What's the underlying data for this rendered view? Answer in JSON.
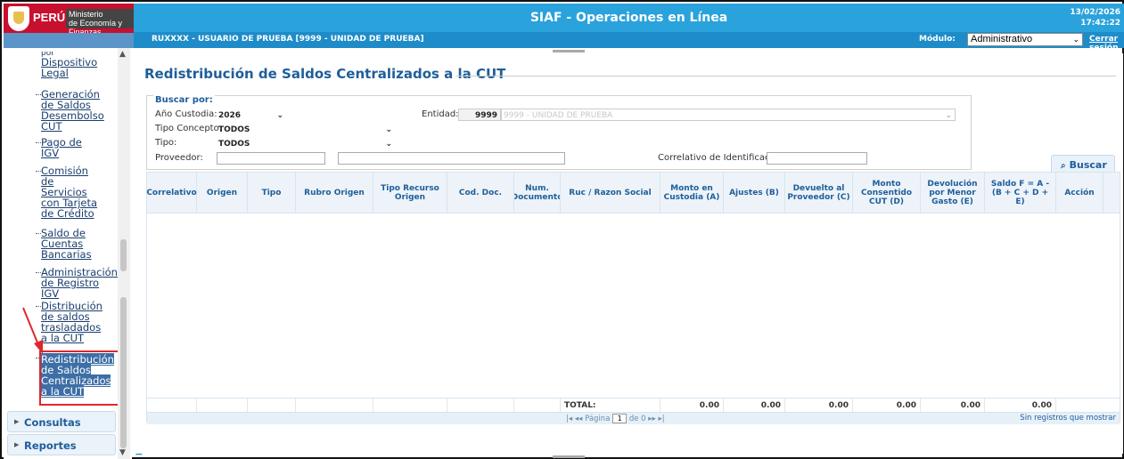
{
  "header": {
    "brand": "PERÚ",
    "ministry_line1": "Ministerio",
    "ministry_line2": "de Economía y Finanzas",
    "app_title": "SIAF - Operaciones en Línea",
    "date": "13/02/2026",
    "time": "17:42:22",
    "user": "RUXXXX - USUARIO DE PRUEBA [9999 - UNIDAD DE PRUEBA]",
    "module_label": "Módulo:",
    "module_value": "Administrativo",
    "logout": "Cerrar sesión"
  },
  "sidebar": {
    "items": [
      {
        "label": "por Dispositivo Legal"
      },
      {
        "label": "Generación de Saldos Desembolso CUT"
      },
      {
        "label": "Pago de IGV"
      },
      {
        "label": "Comisión de Servicios con Tarjeta de Crédito"
      },
      {
        "label": "Saldo de Cuentas Bancarias"
      },
      {
        "label": "Administración de Registro IGV"
      },
      {
        "label": "Distribución de saldos trasladados a la CUT"
      }
    ],
    "active_item": "Redistribución de Saldos Centralizados a la CUT",
    "sections": [
      {
        "label": "Consultas"
      },
      {
        "label": "Reportes"
      }
    ]
  },
  "main": {
    "title": "Redistribución de Saldos Centralizados a la CUT",
    "filters": {
      "legend": "Buscar por:",
      "anio_label": "Año Custodia:",
      "anio_value": "2026",
      "entidad_label": "Entidad:",
      "entidad_code": "9999",
      "entidad_name": "9999 - UNIDAD DE PRUEBA",
      "tipo_concepto_label": "Tipo Concepto:",
      "tipo_concepto_value": "TODOS",
      "tipo_label": "Tipo:",
      "tipo_value": "TODOS",
      "proveedor_label": "Proveedor:",
      "correlativo_label": "Correlativo de Identificación:"
    },
    "search_button": "Buscar",
    "grid": {
      "columns": [
        "Correlativo",
        "Origen",
        "Tipo",
        "Rubro Origen",
        "Tipo Recurso Origen",
        "Cod. Doc.",
        "Num. Documento",
        "Ruc / Razon Social",
        "Monto en Custodia (A)",
        "Ajustes (B)",
        "Devuelto al Proveedor (C)",
        "Monto Consentido CUT (D)",
        "Devolución por Menor Gasto (E)",
        "Saldo F = A - (B + C + D + E)",
        "Acción"
      ],
      "total_label": "TOTAL:",
      "totals": [
        "0.00",
        "0.00",
        "0.00",
        "0.00",
        "0.00",
        "0.00"
      ],
      "pager": {
        "page_label": "Página",
        "page_value": "1",
        "of_label": "de 0",
        "info": "Sin registros que mostrar"
      }
    }
  },
  "colors": {
    "header_blue": "#2aa2dc",
    "title_blue": "#1e5e9a",
    "highlight_red": "#e0262b"
  }
}
